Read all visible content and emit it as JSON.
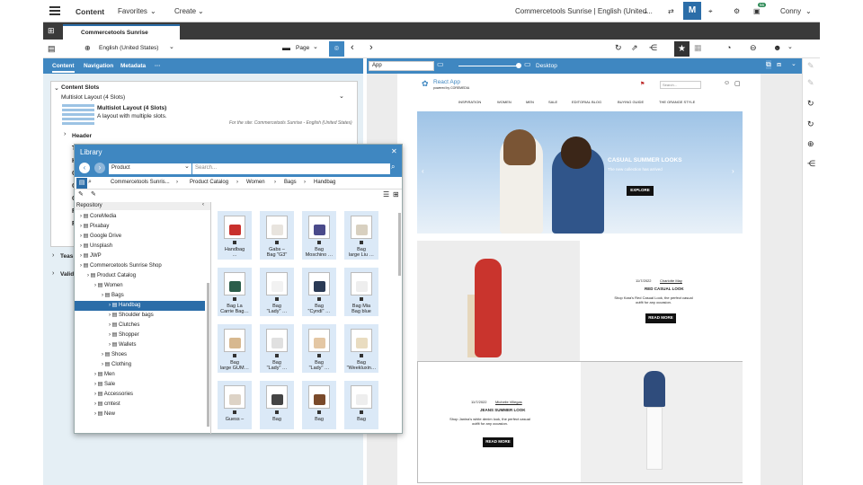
{
  "header": {
    "section": "Content",
    "favorites": "Favorites",
    "create": "Create",
    "site": "Commercetools Sunrise | English (United...",
    "user": "Conny",
    "badge": "56"
  },
  "doc_tab": {
    "label": "Commercetools Sunrise"
  },
  "toolbar2": {
    "locale": "English (United States)",
    "page": "Page"
  },
  "form_tabs": [
    "Content",
    "Navigation",
    "Metadata",
    "···"
  ],
  "form": {
    "content_slots": "Content Slots",
    "layout_select": "Multislot Layout (4 Slots)",
    "layout_title": "Multislot Layout (4 Slots)",
    "layout_desc": "A layout with multiple slots.",
    "site_note": "For the site: Commercetools Sunrise - English (United States)",
    "header": "Header",
    "teasers": "Teas",
    "validity": "Validi",
    "hidden_letters": [
      "T",
      "H",
      "C",
      "C",
      "C",
      "F",
      "F"
    ]
  },
  "preview_bar": {
    "app": "App",
    "device": "Desktop"
  },
  "library": {
    "title": "Library",
    "type": "Product",
    "search_placeholder": "Search...",
    "breadcrumb": [
      "Commercetools Sunris...",
      "Product Catalog",
      "Women",
      "Bags",
      "Handbag"
    ],
    "repo_label": "Repository",
    "tree": [
      {
        "label": "CoreMedia",
        "level": 0
      },
      {
        "label": "Pixabay",
        "level": 0
      },
      {
        "label": "Google Drive",
        "level": 0
      },
      {
        "label": "Unsplash",
        "level": 0
      },
      {
        "label": "JWP",
        "level": 0
      },
      {
        "label": "Commercetools Sunrise Shop",
        "level": 0
      },
      {
        "label": "Product Catalog",
        "level": 1
      },
      {
        "label": "Women",
        "level": 2
      },
      {
        "label": "Bags",
        "level": 3
      },
      {
        "label": "Handbag",
        "level": 4,
        "selected": true
      },
      {
        "label": "Shoulder bags",
        "level": 4
      },
      {
        "label": "Clutches",
        "level": 4
      },
      {
        "label": "Shopper",
        "level": 4
      },
      {
        "label": "Wallets",
        "level": 4
      },
      {
        "label": "Shoes",
        "level": 3
      },
      {
        "label": "Clothing",
        "level": 3
      },
      {
        "label": "Men",
        "level": 2
      },
      {
        "label": "Sale",
        "level": 2
      },
      {
        "label": "Accessories",
        "level": 2
      },
      {
        "label": "cmtest",
        "level": 2
      },
      {
        "label": "New",
        "level": 2
      }
    ],
    "items": [
      [
        "Handbag",
        "…"
      ],
      [
        "Gabs –",
        "Bag \"G3\""
      ],
      [
        "Bag",
        "Moschino …"
      ],
      [
        "Bag",
        "large Liu …"
      ],
      [
        "Bag La",
        "Carrie Bag…"
      ],
      [
        "Bag",
        "\"Lady\" …"
      ],
      [
        "Bag",
        "\"Cyndi\" …"
      ],
      [
        "Bag Mia",
        "Bag blue"
      ],
      [
        "Bag",
        "large GUM…"
      ],
      [
        "Bag",
        "\"Lady\" …"
      ],
      [
        "Bag",
        "\"Lady\" …"
      ],
      [
        "Bag",
        "\"Weekluxin…"
      ],
      [
        "Guess –",
        ""
      ],
      [
        "Bag",
        ""
      ],
      [
        "Bag",
        ""
      ],
      [
        "Bag",
        ""
      ]
    ]
  },
  "site": {
    "logo": "React App",
    "logo_sub": "powered by COREMEDIA",
    "search_placeholder": "Search...",
    "nav": [
      "INSPIRATION",
      "WOMEN",
      "MEN",
      "SALE",
      "EDITORIAL BLOG",
      "BUYING GUIDE",
      "THE ORANGE STYLE"
    ],
    "hero": {
      "title": "CASUAL SUMMER LOOKS",
      "subtitle": "The new collection has arrived",
      "cta": "EXPLORE"
    },
    "teaser1": {
      "date": "11/7/2022",
      "author": "Charlotte May",
      "title": "RED CASUAL LOOK",
      "text": "Shop Kara's Red Casual Look, the perfect casual outfit for any occasion.",
      "cta": "READ MORE"
    },
    "teaser2": {
      "date": "11/7/2022",
      "author": "Michelle Villegas",
      "title": "JEANS SUMMER LOOK",
      "text": "Shop Janina's white denim look, the perfect casual outfit for any occasion.",
      "cta": "READ MORE"
    }
  },
  "colors": {
    "accent": "#3f87c1",
    "dark": "#3a3a3a",
    "thumb_bg": "#dbe9f7"
  }
}
